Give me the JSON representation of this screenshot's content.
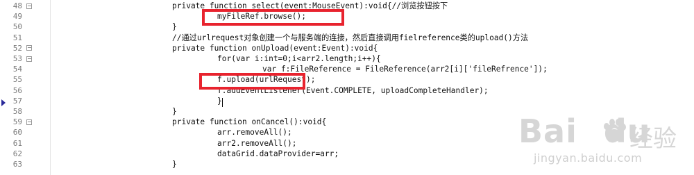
{
  "editor": {
    "lines": [
      {
        "num": "48",
        "fold": "⊟",
        "indent": 0,
        "text": "private function select(event:MouseEvent):void{//浏览按钮按下"
      },
      {
        "num": "49",
        "fold": "",
        "indent": 1,
        "text": "myFileRef.browse();"
      },
      {
        "num": "50",
        "fold": "",
        "indent": 0,
        "text": "}"
      },
      {
        "num": "51",
        "fold": "",
        "indent": 0,
        "text": "//通过urlrequest对象创建一个与服务端的连接，然后直接调用fielreference类的upload()方法"
      },
      {
        "num": "52",
        "fold": "⊟",
        "indent": 0,
        "text": "private function onUpload(event:Event):void{"
      },
      {
        "num": "53",
        "fold": "⊟",
        "indent": 1,
        "text": "for(var i:int=0;i<arr2.length;i++){"
      },
      {
        "num": "54",
        "fold": "",
        "indent": 2,
        "text": "var f:FileReference = FileReference(arr2[i]['fileRefrence']);"
      },
      {
        "num": "55",
        "fold": "",
        "indent": 1,
        "text": "f.upload(urlRequest);"
      },
      {
        "num": "56",
        "fold": "",
        "indent": 1,
        "text": "f.addEventListener(Event.COMPLETE, uploadCompleteHandler);"
      },
      {
        "num": "57",
        "fold": "",
        "indent": 1,
        "text": "}"
      },
      {
        "num": "58",
        "fold": "",
        "indent": 0,
        "text": "}"
      },
      {
        "num": "59",
        "fold": "⊟",
        "indent": 0,
        "text": "private function onCancel():void{"
      },
      {
        "num": "60",
        "fold": "",
        "indent": 1,
        "text": "arr.removeAll();"
      },
      {
        "num": "61",
        "fold": "",
        "indent": 1,
        "text": "arr2.removeAll();"
      },
      {
        "num": "62",
        "fold": "",
        "indent": 1,
        "text": "dataGrid.dataProvider=arr;"
      },
      {
        "num": "63",
        "fold": "",
        "indent": 0,
        "text": "}"
      }
    ]
  },
  "watermark": {
    "logo": "Bai",
    "logo_tail": "du",
    "cn": "经验",
    "url": "jingyan.baidu.com"
  },
  "colors": {
    "highlight_box": "#e8232e",
    "line_number": "#7a7a7a",
    "code_text": "#111111"
  },
  "icons": {
    "fold": "fold-toggle-icon",
    "current_line": "current-line-arrow-icon",
    "watermark": "baidu-paw-icon"
  }
}
